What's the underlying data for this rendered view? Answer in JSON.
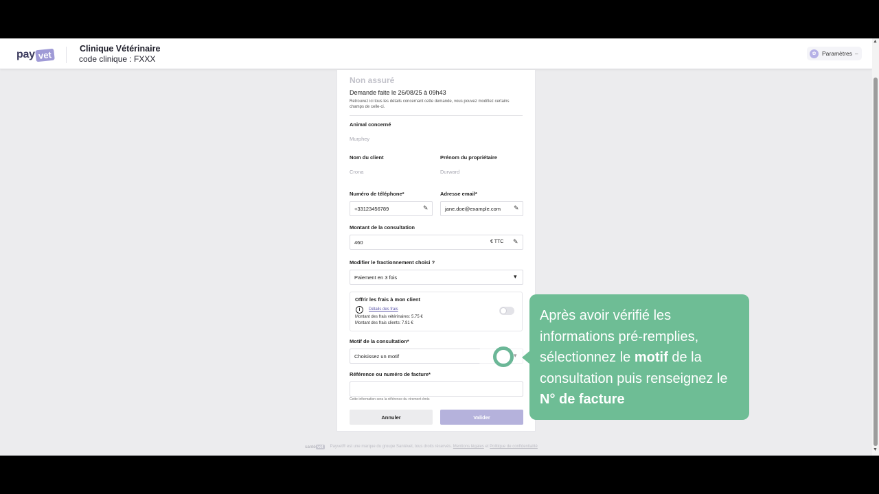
{
  "header": {
    "logo": {
      "pay": "pay",
      "vet": "vet"
    },
    "clinic_name": "Clinique Vétérinaire",
    "clinic_code": "code clinique : FXXX",
    "settings_label": "Paramètres",
    "settings_icon": "paw-icon",
    "settings_chevron": "–"
  },
  "form": {
    "status": "Non assuré",
    "request_date": "Demande faite le 26/08/25 à 09h43",
    "description": "Retrouvez ici tous les détails concernant cette demande, vous pouvez modifiez certains champs de celle-ci.",
    "animal": {
      "label": "Animal concerné",
      "value": "Murphey"
    },
    "client_name": {
      "label": "Nom du client",
      "value": "Crona"
    },
    "owner_firstname": {
      "label": "Prénom du propriétaire",
      "value": "Durward"
    },
    "phone": {
      "label": "Numéro de téléphone*",
      "value": "+33123456789"
    },
    "email": {
      "label": "Adresse email*",
      "value": "jane.doe@example.com"
    },
    "amount": {
      "label": "Montant de la consultation",
      "value": "460",
      "unit": "€ TTC"
    },
    "installments": {
      "label": "Modifier le fractionnement choisi ?",
      "selected": "Paiement en 3 fois"
    },
    "fees": {
      "title": "Offrir les frais à mon client",
      "info_icon": "i",
      "link": "Détails des frais",
      "vet_fees": "Montant des frais vétérinaires: 5.75 €",
      "client_fees": "Montant des frais clients: 7.91 €",
      "toggle_on": false
    },
    "reason": {
      "label": "Motif de la consultation*",
      "placeholder": "Choisissez un motif"
    },
    "invoice": {
      "label": "Référence ou numéro de facture*",
      "value": "",
      "hint": "Cette information sera la référence du virement émis"
    },
    "cancel_label": "Annuler",
    "validate_label": "Valider"
  },
  "footer": {
    "logo_text": "santé",
    "logo_badge": "vet",
    "text": "Payvet® est une marque du groupe Santévet, tous droits réservés.",
    "legal_link": "Mentions légales",
    "and": "et",
    "privacy_link": "Politique de confidentialité"
  },
  "tutorial": {
    "part1": "Après avoir vérifié les informations pré-remplies, sélectionnez le ",
    "bold1": "motif",
    "part2": " de la consultation puis renseignez le ",
    "bold2": "N° de facture"
  },
  "scroll": {
    "up": "▲",
    "down": "▼"
  },
  "icons": {
    "pencil": "✎",
    "caret": "▾"
  },
  "colors": {
    "accent": "#9f9ad6",
    "tooltip": "#6ebd95",
    "validate_disabled": "#b5b2dc"
  }
}
